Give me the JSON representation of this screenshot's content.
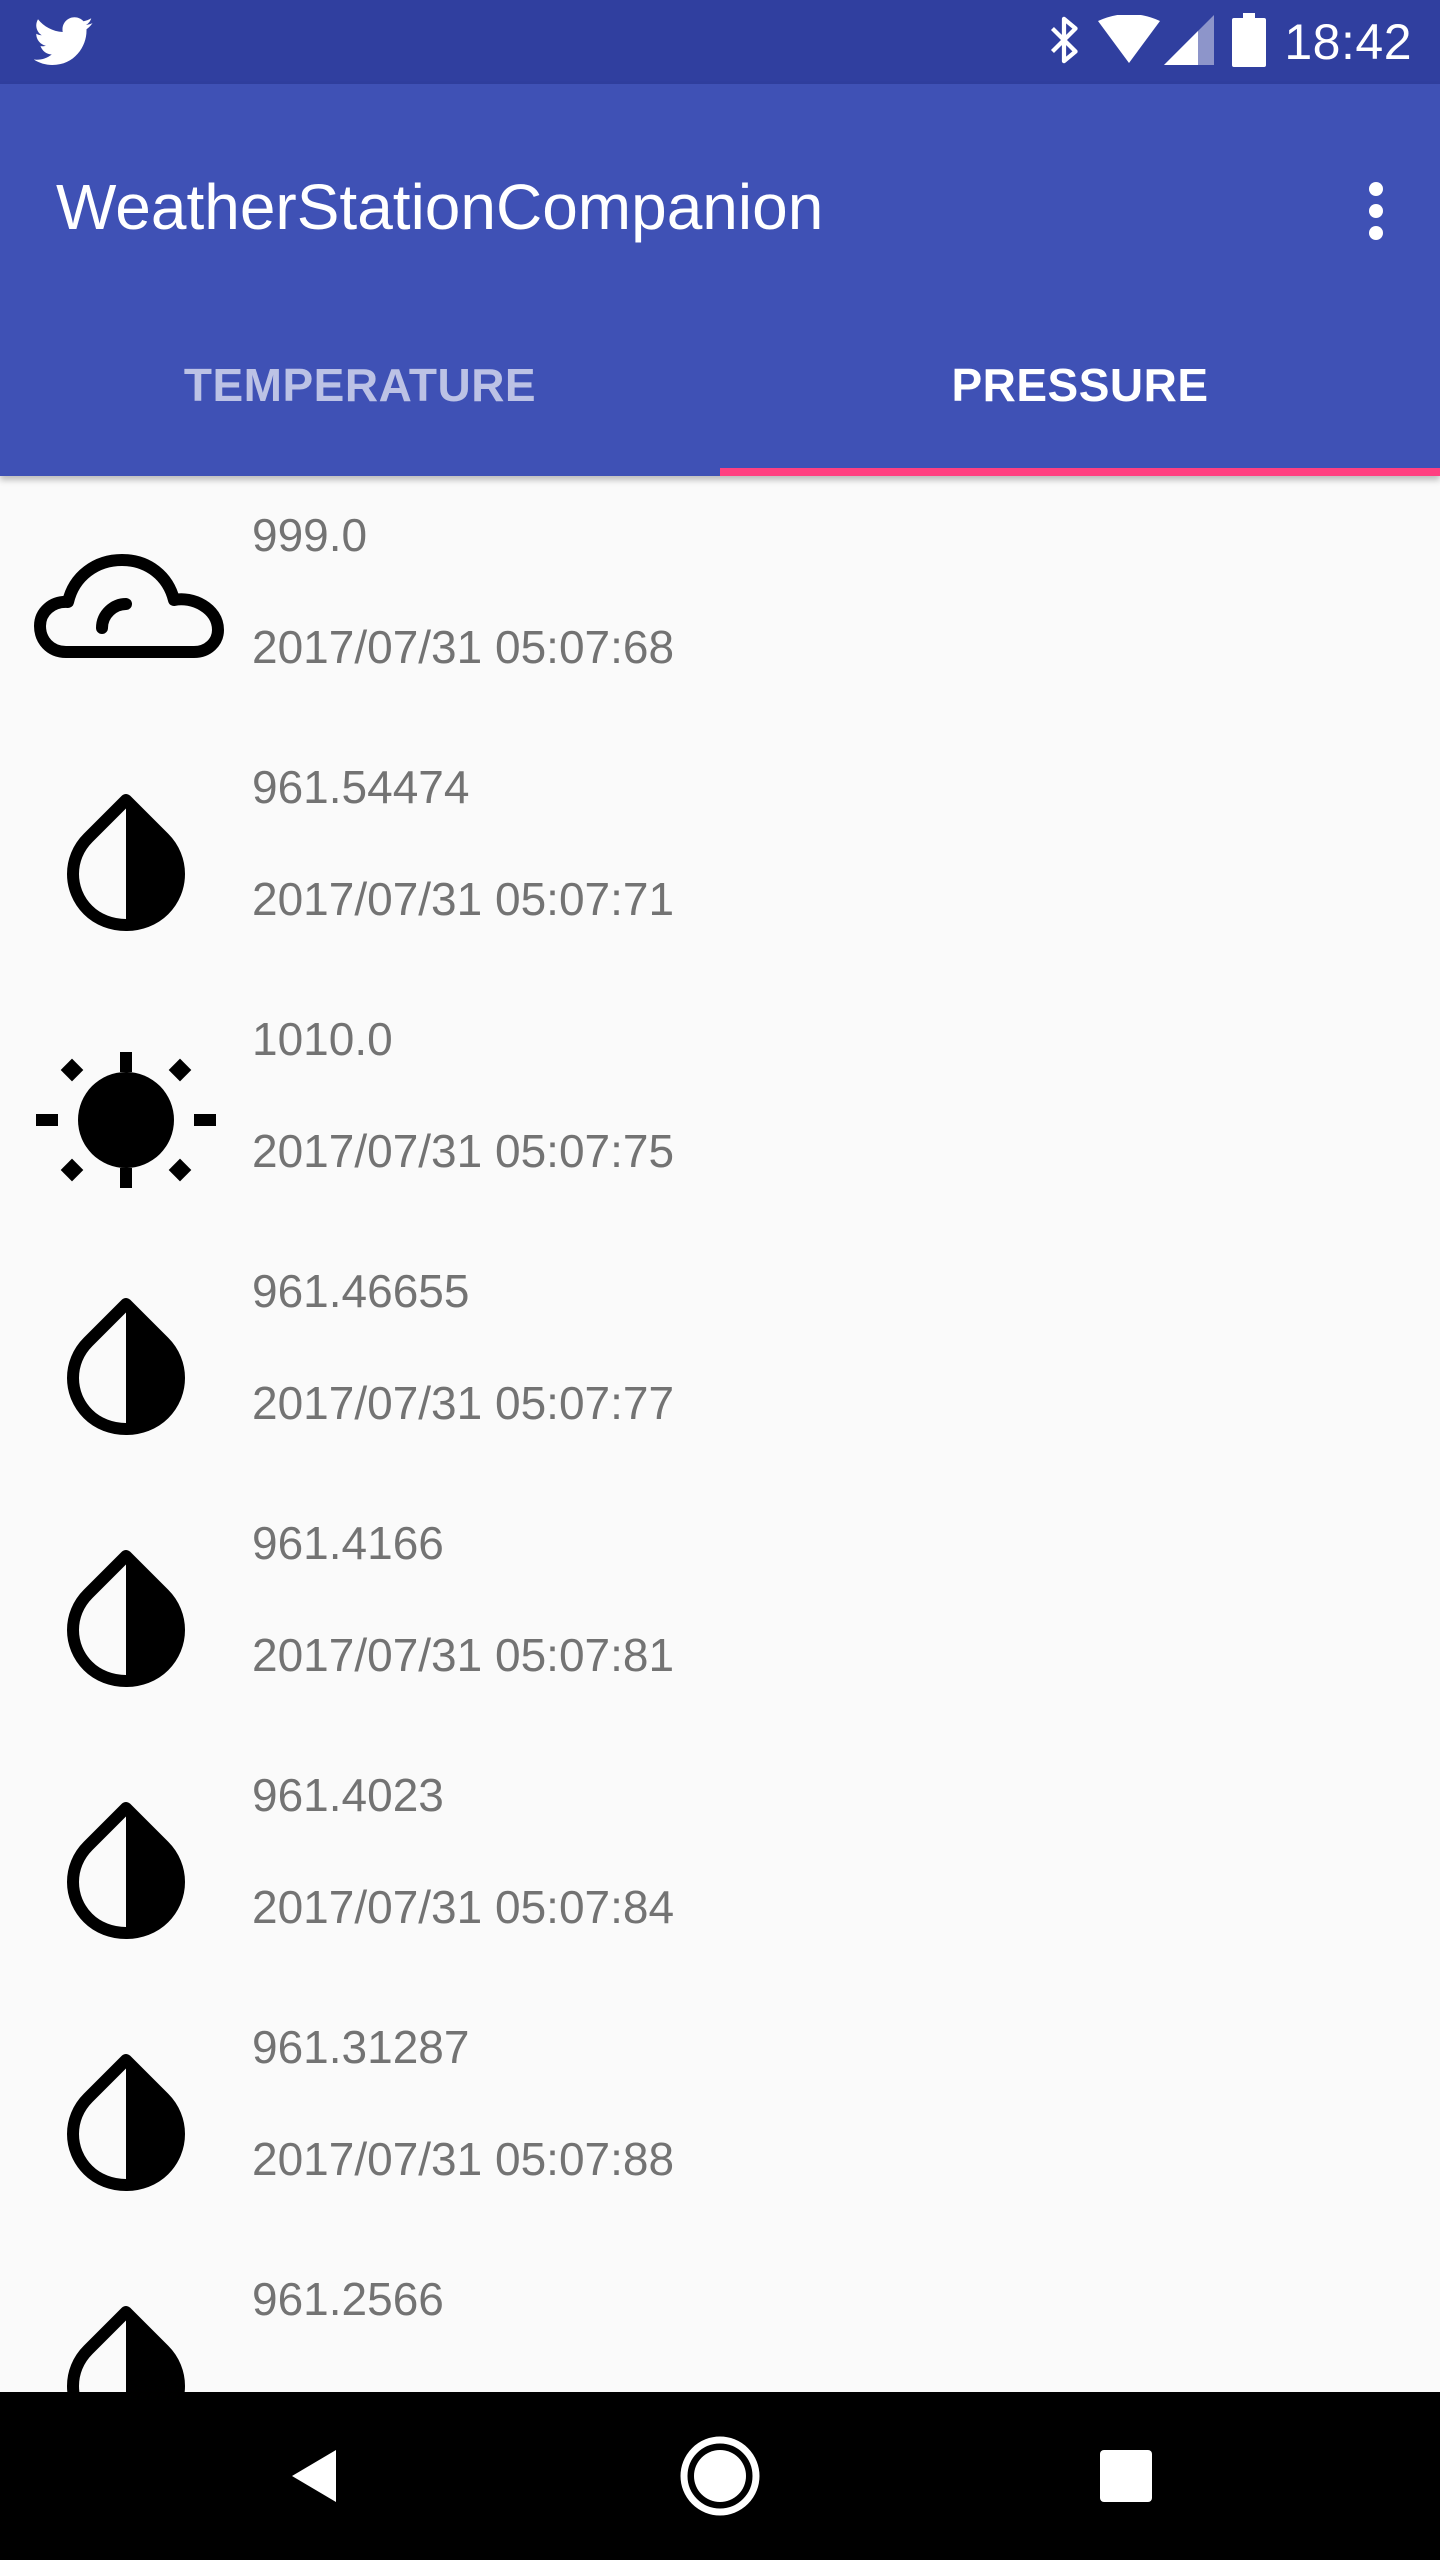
{
  "status_bar": {
    "time": "18:42",
    "left_icon": "twitter-icon",
    "right_icons": [
      "bluetooth-icon",
      "wifi-icon",
      "cell-signal-icon",
      "battery-icon"
    ]
  },
  "app_bar": {
    "title": "WeatherStationCompanion",
    "overflow_icon": "more-vert-icon",
    "color": "#3f51b5",
    "status_color": "#303f9f",
    "accent": "#ff4081"
  },
  "tabs": [
    {
      "label": "TEMPERATURE",
      "selected": false
    },
    {
      "label": "PRESSURE",
      "selected": true
    }
  ],
  "readings": [
    {
      "icon": "cloud-icon",
      "value": "999.0",
      "timestamp": "2017/07/31 05:07:68"
    },
    {
      "icon": "drop-icon",
      "value": "961.54474",
      "timestamp": "2017/07/31 05:07:71"
    },
    {
      "icon": "sun-icon",
      "value": "1010.0",
      "timestamp": "2017/07/31 05:07:75"
    },
    {
      "icon": "drop-icon",
      "value": "961.46655",
      "timestamp": "2017/07/31 05:07:77"
    },
    {
      "icon": "drop-icon",
      "value": "961.4166",
      "timestamp": "2017/07/31 05:07:81"
    },
    {
      "icon": "drop-icon",
      "value": "961.4023",
      "timestamp": "2017/07/31 05:07:84"
    },
    {
      "icon": "drop-icon",
      "value": "961.31287",
      "timestamp": "2017/07/31 05:07:88"
    },
    {
      "icon": "drop-icon",
      "value": "961.2566",
      "timestamp": ""
    }
  ],
  "nav_bar": {
    "back_icon": "back-icon",
    "home_icon": "home-icon",
    "recents_icon": "recents-icon"
  }
}
